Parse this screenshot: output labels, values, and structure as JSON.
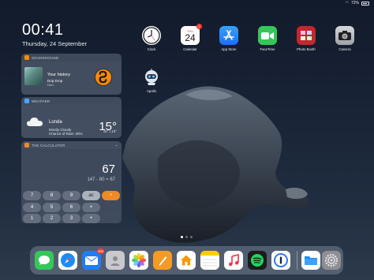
{
  "status_bar": {
    "battery": "72%"
  },
  "clock": {
    "time": "00:41",
    "date": "Thursday, 24 September"
  },
  "widgets": {
    "soundhound": {
      "header": "SOUNDHOUND",
      "title": "Your history",
      "song": "Drip Drop",
      "artist": "Dexi",
      "header_color": "#ff8a00"
    },
    "weather": {
      "header": "WEATHER",
      "city": "Londa",
      "description": "Mostly Cloudy",
      "rain": "Chance of Rain: 30%",
      "temperature": "15°",
      "range": "15° | 15°"
    },
    "calculator": {
      "header": "THE CALCULATOR",
      "display": "67",
      "expression": "147 - 80 = 67",
      "keys": [
        "7",
        "8",
        "9",
        "ac",
        "÷",
        "4",
        "5",
        "6",
        "×",
        "",
        "1",
        "2",
        "3",
        "+",
        "",
        "0",
        ".",
        "=",
        "−",
        ""
      ]
    }
  },
  "home_apps": [
    {
      "label": "Clock",
      "icon": "clock-icon"
    },
    {
      "label": "Calendar",
      "icon": "calendar-icon",
      "day": "THU",
      "date": "24",
      "badge": "1"
    },
    {
      "label": "App Store",
      "icon": "app-store-icon"
    },
    {
      "label": "FaceTime",
      "icon": "facetime-icon"
    },
    {
      "label": "Photo Booth",
      "icon": "photo-booth-icon"
    },
    {
      "label": "Camera",
      "icon": "camera-icon"
    },
    {
      "label": "Apollo",
      "icon": "apollo-icon"
    }
  ],
  "dock": {
    "apps": [
      {
        "name": "messages-icon",
        "color": "#34c759"
      },
      {
        "name": "safari-icon",
        "color": "#1a8cff"
      },
      {
        "name": "mail-icon",
        "color": "#1f7ef5",
        "badge": "668"
      },
      {
        "name": "contacts-icon",
        "color": "#c9c9cd"
      },
      {
        "name": "photos-icon",
        "color": "#ffffff"
      },
      {
        "name": "pages-icon",
        "color": "#f59a23"
      },
      {
        "name": "home-icon",
        "color": "#ffffff"
      },
      {
        "name": "notes-icon",
        "color": "#ffffff"
      },
      {
        "name": "music-icon",
        "color": "#ffffff"
      },
      {
        "name": "spotify-icon",
        "color": "#1c1c1e"
      },
      {
        "name": "1password-icon",
        "color": "#ffffff"
      },
      {
        "name": "files-icon",
        "color": "#ffffff"
      },
      {
        "name": "settings-icon",
        "color": "#8e8e93"
      }
    ]
  }
}
